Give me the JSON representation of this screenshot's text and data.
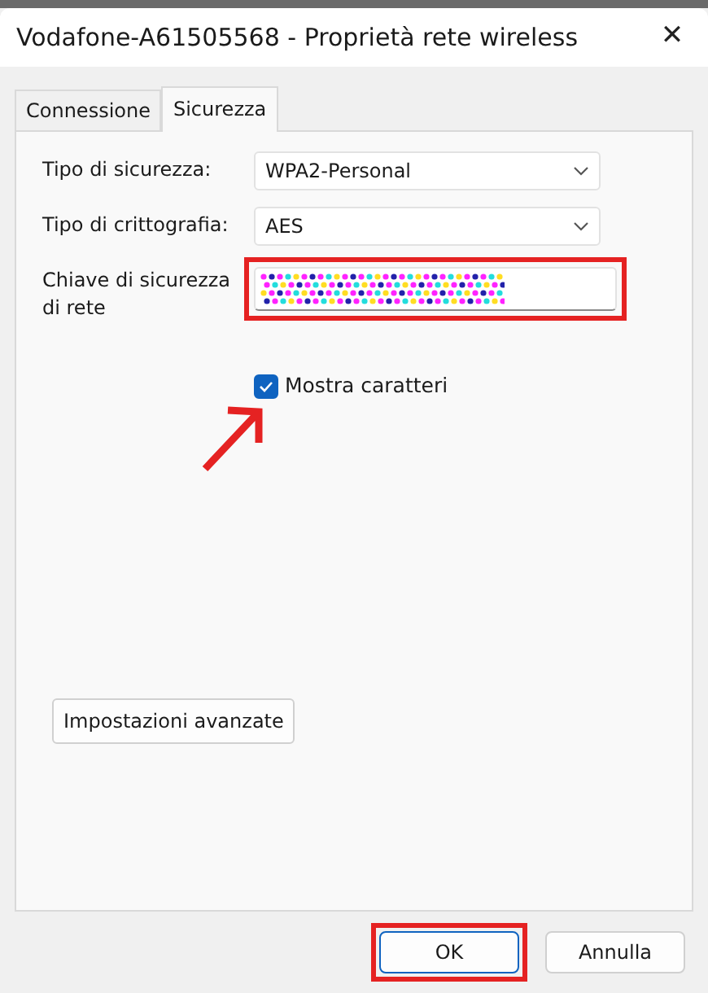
{
  "window": {
    "title": "Vodafone-A61505568 - Proprietà rete wireless",
    "close": "✕"
  },
  "tabs": [
    {
      "label": "Connessione",
      "selected": false
    },
    {
      "label": "Sicurezza",
      "selected": true
    }
  ],
  "fields": [
    {
      "kind": "select",
      "label": "Tipo di sicurezza:",
      "value": "WPA2-Personal"
    },
    {
      "kind": "select",
      "label": "Tipo di crittografia:",
      "value": "AES"
    },
    {
      "kind": "key",
      "label": "Chiave di sicurezza di rete",
      "highlighted": true
    }
  ],
  "show_characters": {
    "label": "Mostra caratteri",
    "checked": true,
    "pointed": true
  },
  "advanced_button": "Impostazioni avanzate",
  "buttons": [
    {
      "label": "OK",
      "highlighted": true
    },
    {
      "label": "Annulla",
      "highlighted": false
    }
  ]
}
